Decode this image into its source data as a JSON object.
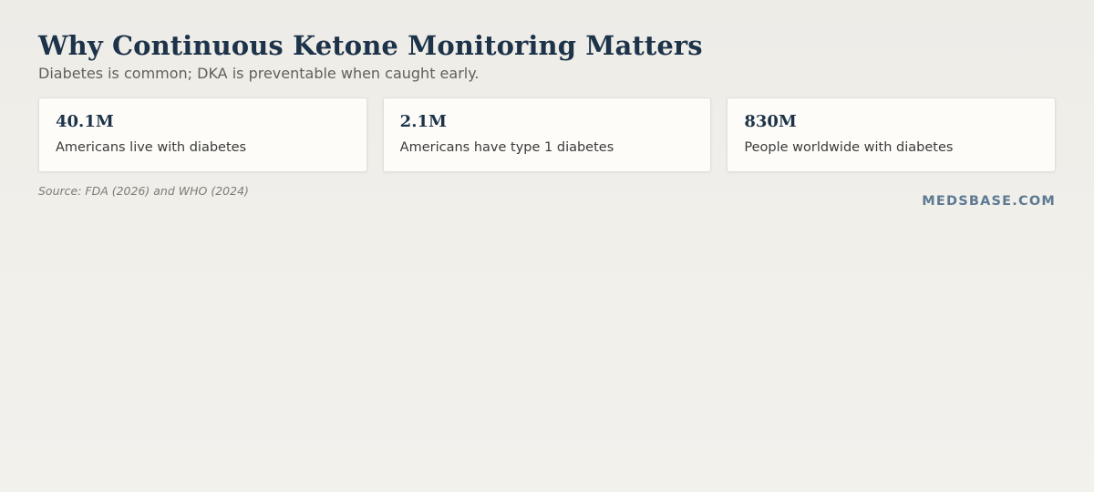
{
  "header": {
    "title": "Why Continuous Ketone Monitoring Matters",
    "subtitle": "Diabetes is common; DKA is preventable when caught early."
  },
  "stats": [
    {
      "value": "40.1M",
      "label": "Americans live with diabetes"
    },
    {
      "value": "2.1M",
      "label": "Americans have type 1 diabetes"
    },
    {
      "value": "830M",
      "label": "People worldwide with diabetes"
    }
  ],
  "footer": {
    "source": "Source: FDA (2026) and WHO (2024)",
    "brand": "MEDSBASE.COM"
  },
  "colors": {
    "heading": "#1d3349",
    "brand": "#5d7a92",
    "card_bg": "#fdfcf9"
  }
}
